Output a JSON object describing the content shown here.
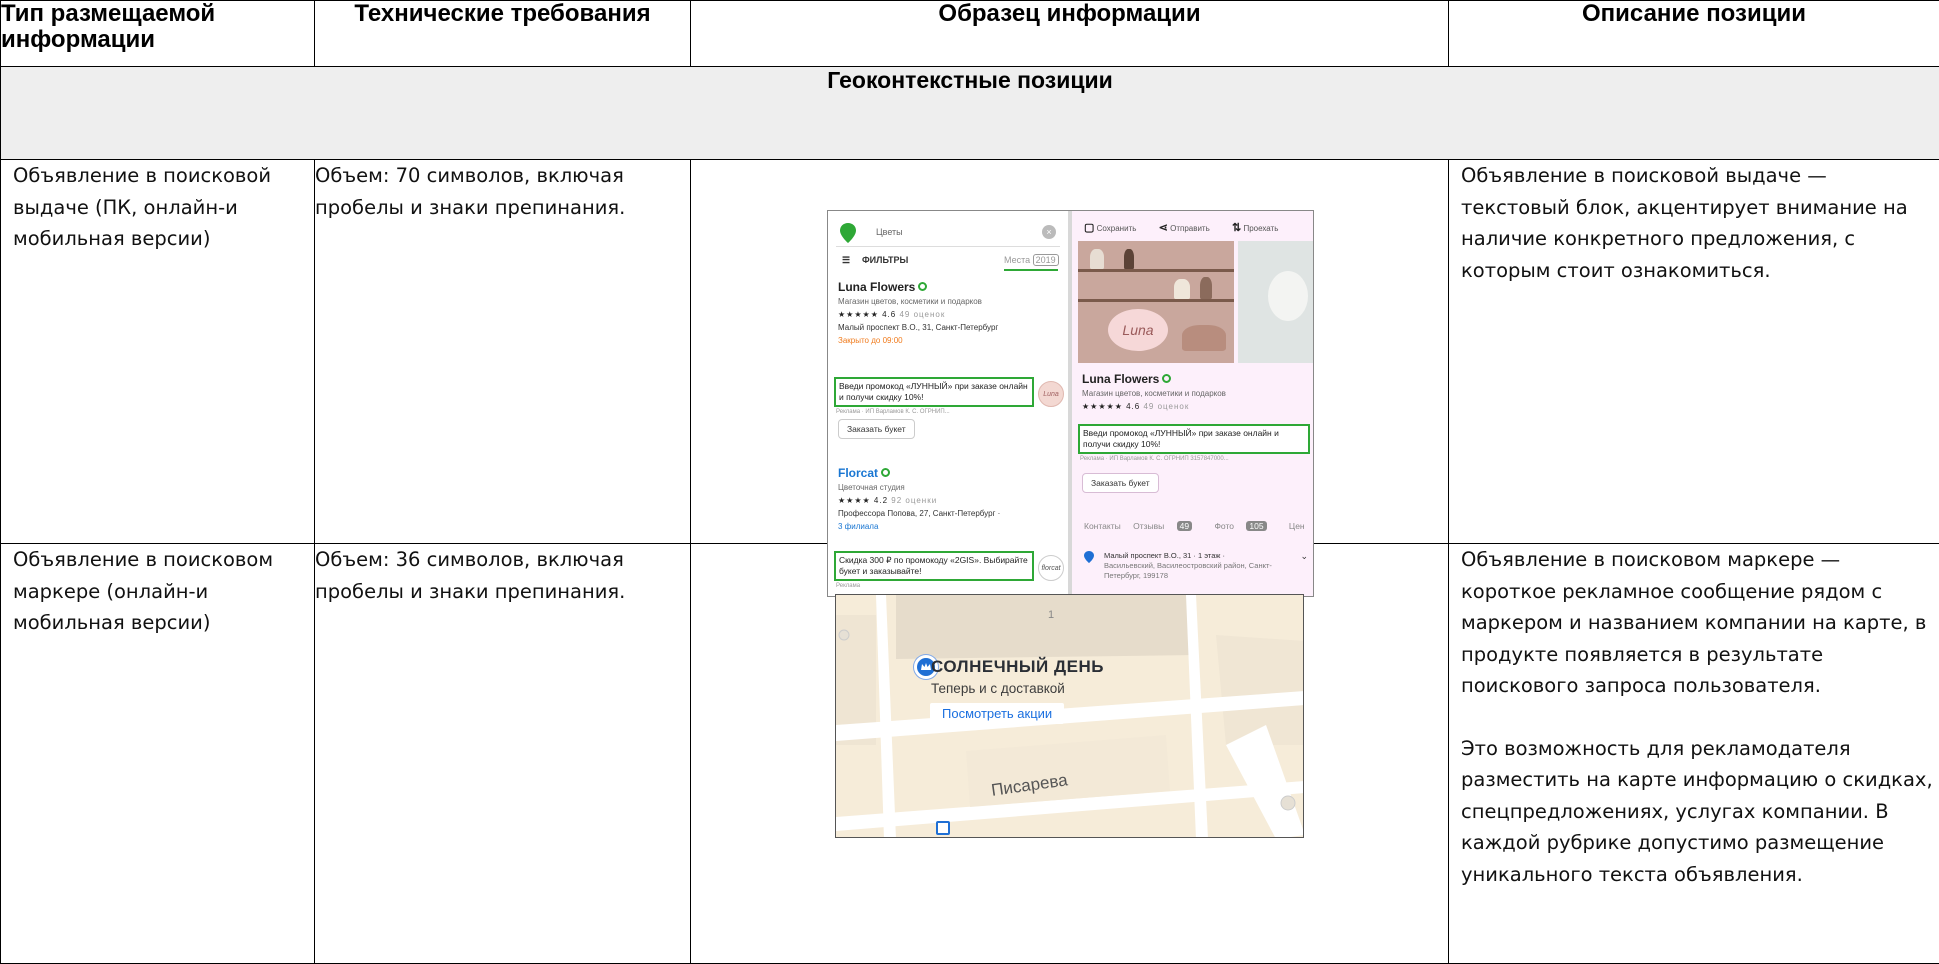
{
  "header": {
    "col1": "Тип размещаемой информации",
    "col2": "Технические требования",
    "col3": "Образец информации",
    "col4": "Описание позиции"
  },
  "section": {
    "title": "Геоконтекстные позиции"
  },
  "rows": [
    {
      "type": "Объявление в поисковой выдаче (ПК, онлайн-и мобильная версии)",
      "requirements": "Объем: 70 символов, включая пробелы и знаки препинания.",
      "description": "Объявление в поисковой выдаче — текстовый блок, акцентирует внимание на наличие конкретного предложения, с которым стоит ознакомиться."
    },
    {
      "type": "Объявление в поисковом маркере (онлайн-и мобильная версии)",
      "requirements": "Объем: 36 символов, включая пробелы и знаки препинания.",
      "description_p1": "Объявление в поисковом маркере — короткое рекламное сообщение рядом с маркером и названием компании на карте, в продукте появляется в результате поискового запроса пользователя.",
      "description_p2": "Это возможность для рекламодателя разместить на карте информацию о скидках, спецпредложениях, услугах компании. В каждой рубрике допустимо размещение уникального текста объявления."
    }
  ],
  "mock1": {
    "search_query": "Цветы",
    "filters_label": "ФИЛЬТРЫ",
    "places_label": "Места",
    "places_count": "2019",
    "actions": {
      "save": "Сохранить",
      "send": "Отправить",
      "route": "Проехать"
    },
    "biz1": {
      "name": "Luna Flowers",
      "category": "Магазин цветов, косметики и подарков",
      "stars": "★★★★★",
      "rating": "4.6",
      "reviews": "49 оценок",
      "address": "Малый проспект В.О., 31, Санкт-Петербург",
      "status": "Закрыто до 09:00",
      "ad_text": "Введи промокод «ЛУННЫЙ» при заказе онлайн и получи скидку 10%!",
      "ad_note": "Реклама · ИП Варламов К. С. ОГРНИП...",
      "logo": "Luna",
      "order_button": "Заказать букет"
    },
    "biz2": {
      "name": "Florcat",
      "category": "Цветочная студия",
      "stars": "★★★★",
      "rating": "4.2",
      "reviews": "92 оценки",
      "address": "Профессора Попова, 27, Санкт-Петербург ·",
      "branches": "3 филиала",
      "ad_text": "Скидка 300 ₽ по промокоду «2GIS». Выбирайте букет и заказывайте!",
      "ad_note": "Реклама",
      "logo": "florcat"
    },
    "card": {
      "name": "Luna Flowers",
      "category": "Магазин цветов, косметики и подарков",
      "stars": "★★★★★",
      "rating": "4.6",
      "reviews": "49 оценок",
      "ad_text": "Введи промокод «ЛУННЫЙ» при заказе онлайн и получи скидку 10%!",
      "ad_note": "Реклама · ИП Варламов К. С. ОГРНИП 3157847000...",
      "order_button": "Заказать букет",
      "photo_sign": "Luna",
      "tabs": {
        "contacts": "Контакты",
        "reviews": "Отзывы",
        "reviews_count": "49",
        "photo": "Фото",
        "photo_count": "105",
        "prices": "Цен",
        "more": "›"
      },
      "address_line1": "Малый проспект В.О., 31 · 1 этаж ·",
      "address_line2": "Васильевский, Василеостровский район, Санкт-Петербург, 199178",
      "chevron": "⌄"
    }
  },
  "mock2": {
    "building_number": "1",
    "company": "СОЛНЕЧНЫЙ ДЕНЬ",
    "ad_text": "Теперь и с доставкой",
    "button": "Посмотреть акции",
    "street": "Писарева"
  },
  "colors": {
    "ad_border": "#2ea836",
    "link_blue": "#1976d2",
    "section_bg": "#eeeeee",
    "map_bg": "#f6ecd9"
  }
}
